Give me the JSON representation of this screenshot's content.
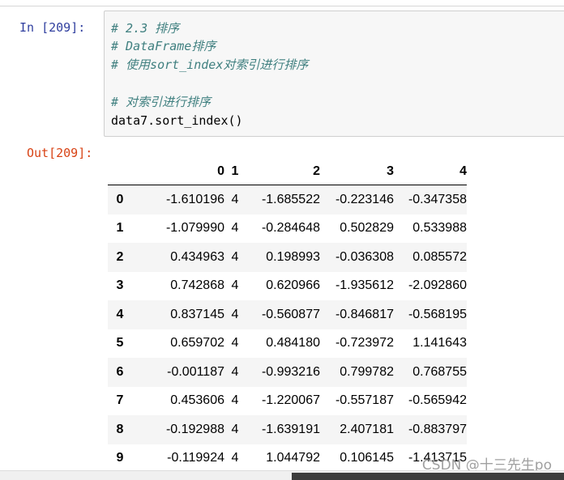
{
  "cell": {
    "in_prompt": "In  [209]:",
    "out_prompt": "Out[209]:",
    "code_lines": [
      "# 2.3 排序",
      "# DataFrame排序",
      "# 使用sort_index对索引进行排序",
      "",
      "# 对索引进行排序",
      "data7.sort_index()"
    ]
  },
  "output_table": {
    "columns": [
      "",
      "0",
      "1",
      "2",
      "3",
      "4"
    ],
    "rows": [
      {
        "index": "0",
        "values": [
          "-1.610196",
          "4",
          "-1.685522",
          "-0.223146",
          "-0.347358"
        ]
      },
      {
        "index": "1",
        "values": [
          "-1.079990",
          "4",
          "-0.284648",
          "0.502829",
          "0.533988"
        ]
      },
      {
        "index": "2",
        "values": [
          "0.434963",
          "4",
          "0.198993",
          "-0.036308",
          "0.085572"
        ]
      },
      {
        "index": "3",
        "values": [
          "0.742868",
          "4",
          "0.620966",
          "-1.935612",
          "-2.092860"
        ]
      },
      {
        "index": "4",
        "values": [
          "0.837145",
          "4",
          "-0.560877",
          "-0.846817",
          "-0.568195"
        ]
      },
      {
        "index": "5",
        "values": [
          "0.659702",
          "4",
          "0.484180",
          "-0.723972",
          "1.141643"
        ]
      },
      {
        "index": "6",
        "values": [
          "-0.001187",
          "4",
          "-0.993216",
          "0.799782",
          "0.768755"
        ]
      },
      {
        "index": "7",
        "values": [
          "0.453606",
          "4",
          "-1.220067",
          "-0.557187",
          "-0.565942"
        ]
      },
      {
        "index": "8",
        "values": [
          "-0.192988",
          "4",
          "-1.639191",
          "2.407181",
          "-0.883797"
        ]
      },
      {
        "index": "9",
        "values": [
          "-0.119924",
          "4",
          "1.044792",
          "0.106145",
          "-1.413715"
        ]
      }
    ]
  },
  "watermark": "CSDN @十三先生po"
}
